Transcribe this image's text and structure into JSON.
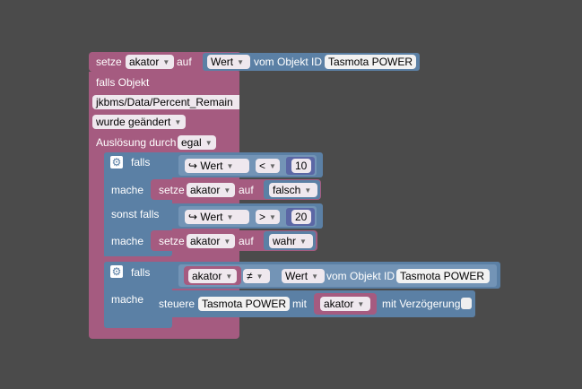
{
  "outer": {
    "setze": "setze",
    "var_name": "akator",
    "auf": "auf",
    "wert_label": "Wert",
    "vom_objekt_id": "vom Objekt ID",
    "object_id": "Tasmota POWER"
  },
  "trigger": {
    "falls_objekt": "falls Objekt",
    "path": "jkbms/Data/Percent_Remain",
    "event": "wurde geändert",
    "ausloesung_label": "Auslösung durch",
    "ausloesung_value": "egal"
  },
  "if1": {
    "falls": "falls",
    "cond1_wert": "Wert",
    "cond1_op": "<",
    "cond1_num": "10",
    "mache": "mache",
    "set1_setze": "setze",
    "set1_var": "akator",
    "set1_auf": "auf",
    "set1_value": "falsch",
    "sonst_falls": "sonst falls",
    "cond2_wert": "Wert",
    "cond2_op": ">",
    "cond2_num": "20",
    "mache2": "mache",
    "set2_setze": "setze",
    "set2_var": "akator",
    "set2_auf": "auf",
    "set2_value": "wahr"
  },
  "if2": {
    "falls": "falls",
    "cond_var": "akator",
    "cond_op": "≠",
    "cond_wert": "Wert",
    "vom_objekt_id": "vom Objekt ID",
    "object_id": "Tasmota POWER",
    "mache": "mache",
    "steuere": "steuere",
    "steuere_target": "Tasmota POWER",
    "mit": "mit",
    "mit_var": "akator",
    "mit_verzoegerung": "mit Verzögerung"
  },
  "icons": {
    "gear": "gear-icon",
    "return_arrow": "return-arrow-icon",
    "dropdown": "dropdown-arrow-icon"
  },
  "colors": {
    "workspace": "#4b4b4b",
    "event_block": "#a55b80",
    "logic_block": "#5b80a5"
  }
}
